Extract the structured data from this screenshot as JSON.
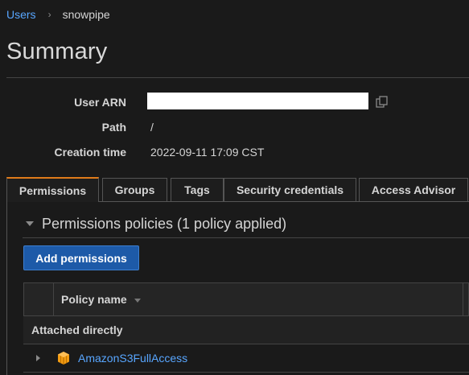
{
  "breadcrumb": {
    "parent": "Users",
    "current": "snowpipe"
  },
  "page_title": "Summary",
  "summary": {
    "arn_label": "User ARN",
    "path_label": "Path",
    "path_value": "/",
    "created_label": "Creation time",
    "created_value": "2022-09-11 17:09 CST"
  },
  "tabs": [
    {
      "label": "Permissions",
      "active": true
    },
    {
      "label": "Groups"
    },
    {
      "label": "Tags"
    },
    {
      "label": "Security credentials"
    },
    {
      "label": "Access Advisor"
    }
  ],
  "permissions": {
    "section_title": "Permissions policies (1 policy applied)",
    "add_button": "Add permissions",
    "column_policy_name": "Policy name",
    "group_label": "Attached directly",
    "policies": [
      {
        "name": "AmazonS3FullAccess",
        "icon": "aws-cube-icon"
      }
    ]
  },
  "colors": {
    "accent_tab": "#e07b1a",
    "link": "#58a6ff",
    "primary_button": "#1d5aa8",
    "policy_icon": "#f39c12"
  }
}
